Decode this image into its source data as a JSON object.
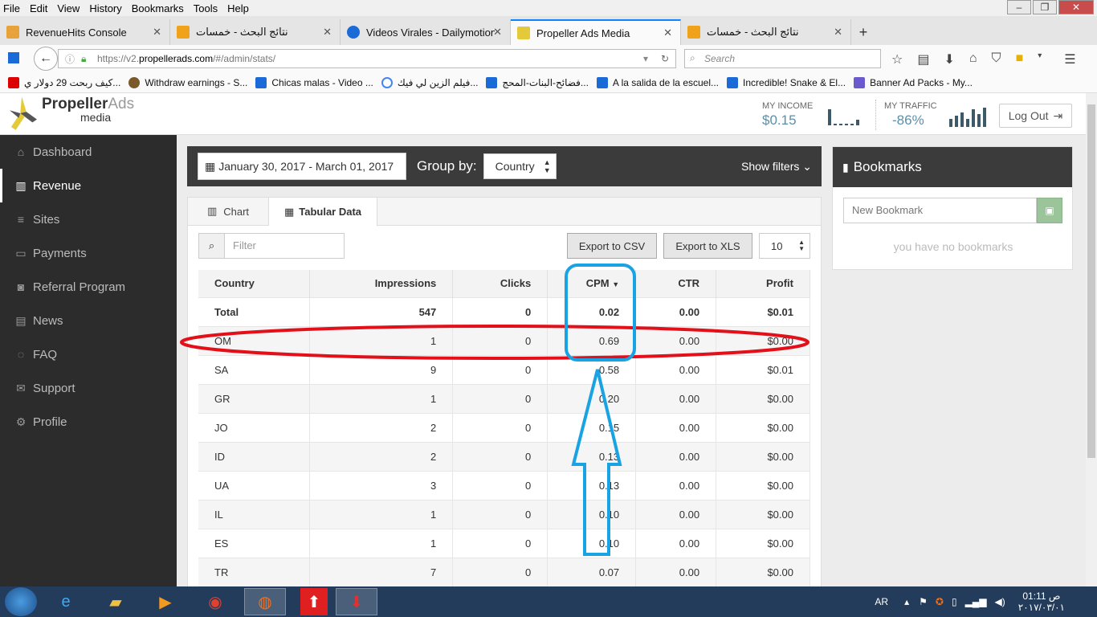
{
  "menubar": {
    "items": [
      "File",
      "Edit",
      "View",
      "History",
      "Bookmarks",
      "Tools",
      "Help"
    ]
  },
  "window_controls": {
    "minimize": "–",
    "maximize": "❐",
    "close": "✕"
  },
  "tabs": [
    {
      "title": "RevenueHits Console",
      "color": "#e8a23a"
    },
    {
      "title": "نتائج البحث - خمسات",
      "color": "#f0a21a"
    },
    {
      "title": "Videos Virales - Dailymotion",
      "color": "#1a6ad8"
    },
    {
      "title": "Propeller Ads Media",
      "color": "#e4c93a"
    },
    {
      "title": "نتائج البحث - خمسات",
      "color": "#f0a21a"
    }
  ],
  "address": {
    "prefix": "https://v2.",
    "host": "propellerads.com",
    "path": "/#/admin/stats/"
  },
  "search_placeholder": "Search",
  "bookmarks_bar": [
    {
      "label": "كيف ربحت 29 دولار ي...",
      "color": "#d00"
    },
    {
      "label": "Withdraw earnings - S...",
      "color": "#7a5a2a"
    },
    {
      "label": "Chicas malas - Video ...",
      "color": "#1a6ad8"
    },
    {
      "label": "فيلم الزين لي فيك...",
      "color": "#4285f4"
    },
    {
      "label": "فضائح-البنات-المحج...",
      "color": "#1a6ad8"
    },
    {
      "label": "A la salida de la escuel...",
      "color": "#1a6ad8"
    },
    {
      "label": "Incredible! Snake & El...",
      "color": "#1a6ad8"
    },
    {
      "label": "Banner Ad Packs - My...",
      "color": "#6a5acd"
    }
  ],
  "header": {
    "logo_brand_a": "Propeller",
    "logo_brand_b": "Ads",
    "logo_sub": "media",
    "income_label": "MY INCOME",
    "income_value": "$0.15",
    "traffic_label": "MY TRAFFIC",
    "traffic_value": "-86%",
    "logout": "Log Out"
  },
  "sidebar": [
    {
      "label": "Dashboard",
      "icon": "⌂",
      "name": "home-icon"
    },
    {
      "label": "Revenue",
      "icon": "▥",
      "name": "bar-chart-icon",
      "active": true
    },
    {
      "label": "Sites",
      "icon": "≡",
      "name": "list-icon"
    },
    {
      "label": "Payments",
      "icon": "▭",
      "name": "credit-card-icon"
    },
    {
      "label": "Referral Program",
      "icon": "◙",
      "name": "money-icon"
    },
    {
      "label": "News",
      "icon": "▤",
      "name": "newspaper-icon"
    },
    {
      "label": "FAQ",
      "icon": "◌",
      "name": "comment-icon"
    },
    {
      "label": "Support",
      "icon": "✉",
      "name": "envelope-icon"
    },
    {
      "label": "Profile",
      "icon": "⚙",
      "name": "cogs-icon"
    }
  ],
  "filters": {
    "date_range": "January 30, 2017 - March 01, 2017",
    "group_by_label": "Group by:",
    "group_by_value": "Country",
    "show_filters": "Show filters"
  },
  "panel": {
    "tab_chart": "Chart",
    "tab_table": "Tabular Data",
    "filter_placeholder": "Filter",
    "export_csv": "Export to CSV",
    "export_xls": "Export to XLS",
    "per_page": "10"
  },
  "table": {
    "headers": [
      "Country",
      "Impressions",
      "Clicks",
      "CPM",
      "CTR",
      "Profit"
    ],
    "rows": [
      [
        "Total",
        "547",
        "0",
        "0.02",
        "0.00",
        "$0.01"
      ],
      [
        "OM",
        "1",
        "0",
        "0.69",
        "0.00",
        "$0.00"
      ],
      [
        "SA",
        "9",
        "0",
        "0.58",
        "0.00",
        "$0.01"
      ],
      [
        "GR",
        "1",
        "0",
        "0.20",
        "0.00",
        "$0.00"
      ],
      [
        "JO",
        "2",
        "0",
        "0.15",
        "0.00",
        "$0.00"
      ],
      [
        "ID",
        "2",
        "0",
        "0.13",
        "0.00",
        "$0.00"
      ],
      [
        "UA",
        "3",
        "0",
        "0.13",
        "0.00",
        "$0.00"
      ],
      [
        "IL",
        "1",
        "0",
        "0.10",
        "0.00",
        "$0.00"
      ],
      [
        "ES",
        "1",
        "0",
        "0.10",
        "0.00",
        "$0.00"
      ],
      [
        "TR",
        "7",
        "0",
        "0.07",
        "0.00",
        "$0.00"
      ]
    ]
  },
  "bookmarks_panel": {
    "title": "Bookmarks",
    "placeholder": "New Bookmark",
    "empty": "you have no bookmarks"
  },
  "taskbar": {
    "lang": "AR",
    "time": "01:11 ص",
    "date": "٢٠١٧/٠٣/٠١"
  },
  "colors": {
    "annotation_red": "#e3101a",
    "annotation_blue": "#1aa3e3",
    "sidebar_bg": "#2c2c2c"
  }
}
